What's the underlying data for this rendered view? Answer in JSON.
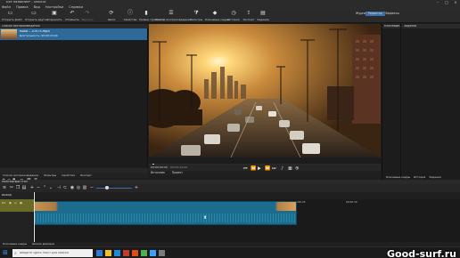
{
  "window": {
    "title": "Без названия* - Shotcut"
  },
  "menu": [
    "Файл",
    "Правка",
    "Вид",
    "Настройки",
    "Справка"
  ],
  "toolbar": [
    {
      "label": "Открыть файл",
      "icon": "open-folder-icon"
    },
    {
      "label": "Открыть другое",
      "icon": "open-other-icon"
    },
    {
      "label": "Сохранить",
      "icon": "save-icon"
    },
    {
      "label": "Отменить",
      "icon": "undo-icon"
    },
    {
      "label": "Вернуть",
      "icon": "redo-icon"
    },
    {
      "label": "Шаги",
      "icon": "history-icon"
    },
    {
      "label": "Свойства",
      "icon": "properties-icon"
    },
    {
      "label": "Уровни громкости",
      "icon": "audio-meter-icon"
    },
    {
      "label": "Список воспроизведения",
      "icon": "playlist-icon"
    },
    {
      "label": "Фильтры",
      "icon": "filters-icon"
    },
    {
      "label": "Ключевые кадры",
      "icon": "keyframes-icon"
    },
    {
      "label": "История",
      "icon": "history-clock-icon"
    },
    {
      "label": "Экспорт",
      "icon": "export-icon"
    },
    {
      "label": "Задание",
      "icon": "jobs-icon"
    }
  ],
  "layouts": {
    "items": [
      "Журнал",
      "Редактор",
      "Эффекты"
    ],
    "active": "Редактор"
  },
  "playlist": {
    "title": "Список воспроизведения",
    "clip_name": "Road – 10973.mp4",
    "clip_duration": "Длительность: 00:00:24:00",
    "tabs": [
      "Список воспроизведения",
      "Фильтры",
      "Свойства",
      "Экспорт"
    ]
  },
  "viewer": {
    "timecode_start": "00:00:00:00",
    "timecode_end": "00:00:24:00",
    "ruler": [
      "00:00:00",
      "00:00:05",
      "00:00:10",
      "00:00:15",
      "00:00:20"
    ],
    "tabs": [
      "Источник",
      "Проект"
    ]
  },
  "right_column": {
    "panel_left": "Ключевые...",
    "panel_right": "Задания",
    "tabs": [
      "Ключевые кадры",
      "История",
      "Задания"
    ]
  },
  "timeline": {
    "title": "Монтажный стол",
    "track_name": "Выход",
    "track_label": "V1",
    "ruler": [
      "00:00:00",
      "00:00:05",
      "00:00:10",
      "00:00:15",
      "00:00:20",
      "00:00:25",
      "00:00:30"
    ],
    "bottom_tabs": [
      "Ключевые кадры",
      "Шкала времени"
    ]
  },
  "taskbar": {
    "search_placeholder": "Введите здесь текст для поиска"
  },
  "watermark": "Good-surf.ru"
}
